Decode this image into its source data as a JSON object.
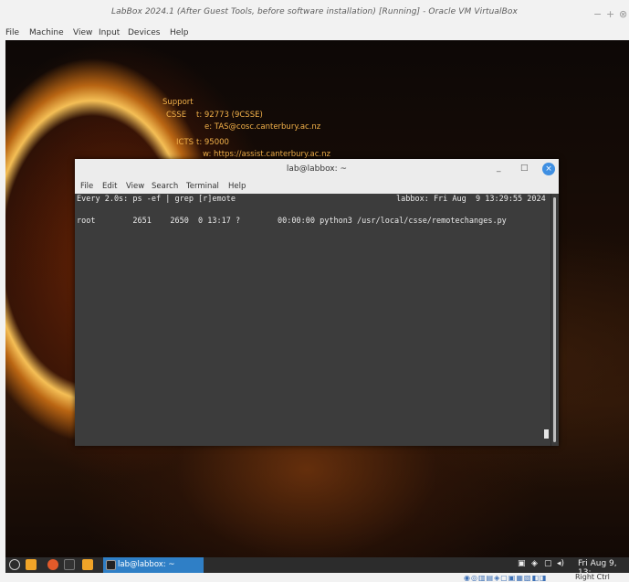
{
  "vbox": {
    "title": "LabBox 2024.1 (After Guest Tools, before software installation) [Running] - Oracle VM VirtualBox",
    "menu": [
      "File",
      "Machine",
      "View",
      "Input",
      "Devices",
      "Help"
    ],
    "controls": [
      "−",
      "+",
      "⊗"
    ]
  },
  "desktop": {
    "support_heading": "Support",
    "csse_label": "CSSE",
    "csse_phone": "t: 92773 (9CSSE)",
    "csse_email": "e: TAS@cosc.canterbury.ac.nz",
    "icts_label": "ICTS",
    "icts_phone": "t: 95000",
    "icts_web": "w: https://assist.canterbury.ac.nz"
  },
  "terminal": {
    "title": "lab@labbox: ~",
    "menu": [
      "File",
      "Edit",
      "View",
      "Search",
      "Terminal",
      "Help"
    ],
    "line1_left": "Every 2.0s: ps -ef | grep [r]emote",
    "line1_right": "labbox: Fri Aug  9 13:29:55 2024",
    "line2": "root        2651    2650  0 13:17 ?        00:00:00 python3 /usr/local/csse/remotechanges.py",
    "controls": [
      "_",
      "□",
      "×"
    ]
  },
  "taskbar": {
    "task_label": "lab@labbox: ~",
    "clock": "Fri Aug  9, 13:"
  },
  "host": {
    "hostkey": "Right Ctrl"
  }
}
